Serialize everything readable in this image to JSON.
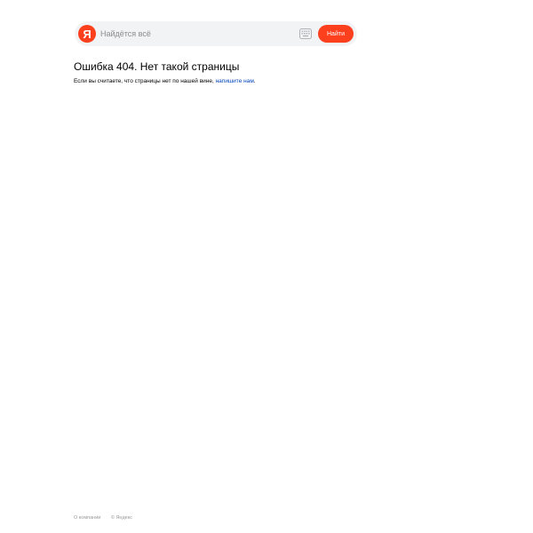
{
  "search": {
    "logo_letter": "Я",
    "placeholder": "Найдётся всё",
    "value": "",
    "button_label": "Найти",
    "keyboard_icon": "keyboard-icon",
    "logo_icon": "yandex-logo-icon"
  },
  "error": {
    "title": "Ошибка 404. Нет такой страницы",
    "message_prefix": "Если вы считаете, что страницы нет по нашей вине, ",
    "message_link": "напишите нам",
    "message_suffix": "."
  },
  "footer": {
    "about_link": "О компании",
    "copyright": "© Яндекс"
  },
  "colors": {
    "accent": "#fc3f1d",
    "link": "#0044bb",
    "muted": "#999999",
    "search_bg": "#f2f3f5"
  }
}
